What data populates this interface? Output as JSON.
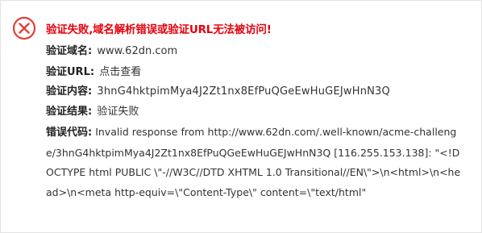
{
  "title": "验证失败,域名解析错误或验证URL无法被访问!",
  "colors": {
    "error_red": "#e8000b",
    "link_green": "#2a9d2a",
    "icon_red": "#e0413a"
  },
  "icon": "error-circle-x-icon",
  "fields": {
    "domain": {
      "label": "验证域名:",
      "value": "www.62dn.com"
    },
    "url": {
      "label": "验证URL:",
      "link_text": "点击查看"
    },
    "content": {
      "label": "验证内容:",
      "value": "3hnG4hktpimMya4J2Zt1nx8EfPuQGeEwHuGEJwHnN3Q"
    },
    "result": {
      "label": "验证结果:",
      "value": "验证失败"
    },
    "error_code": {
      "label": "错误代码:",
      "value": "Invalid response from http://www.62dn.com/.well-known/acme-challenge/3hnG4hktpimMya4J2Zt1nx8EfPuQGeEwHuGEJwHnN3Q [116.255.153.138]: \"<!DOCTYPE html PUBLIC \\\"-//W3C//DTD XHTML 1.0 Transitional//EN\\\">\\n<html>\\n<head>\\n<meta http-equiv=\\\"Content-Type\\\" content=\\\"text/html\""
    }
  }
}
